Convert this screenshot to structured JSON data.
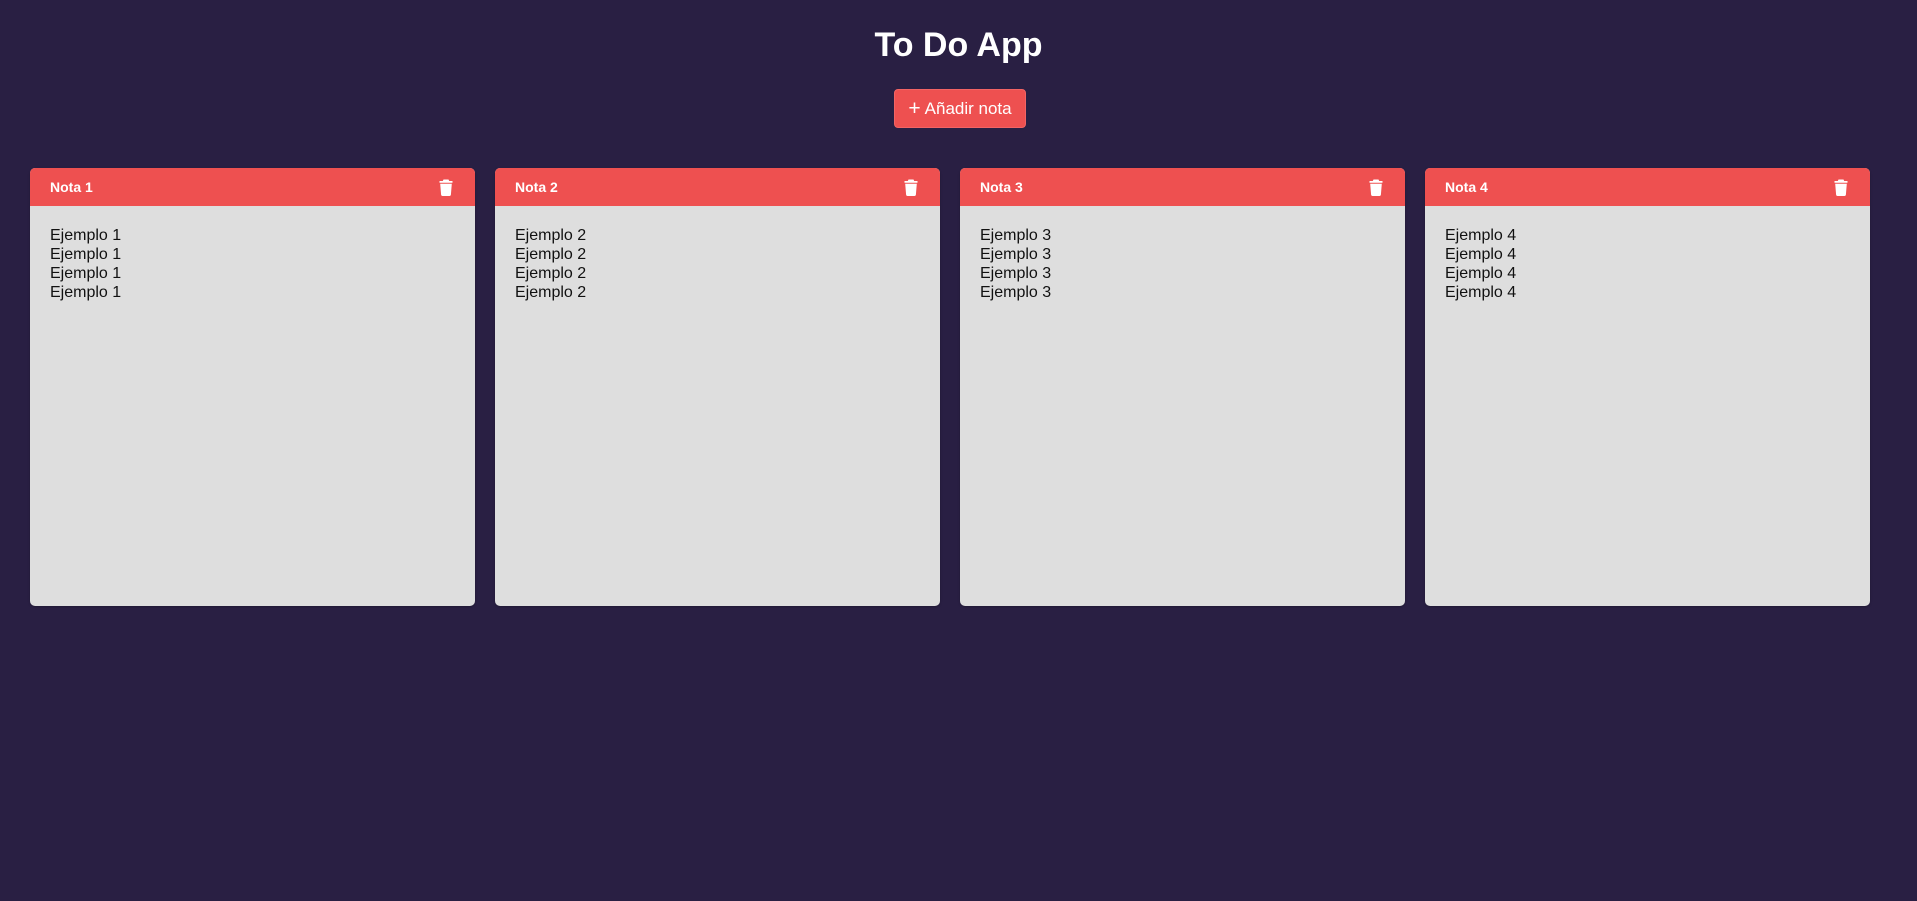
{
  "header": {
    "title": "To Do App"
  },
  "toolbar": {
    "add_icon": "+",
    "add_label": "Añadir nota"
  },
  "notes": [
    {
      "title": "Nota 1",
      "delete_icon": "trash-icon",
      "lines": [
        "Ejemplo 1",
        "Ejemplo 1",
        "Ejemplo 1",
        "Ejemplo 1"
      ]
    },
    {
      "title": "Nota 2",
      "delete_icon": "trash-icon",
      "lines": [
        "Ejemplo 2",
        "Ejemplo 2",
        "Ejemplo 2",
        "Ejemplo 2"
      ]
    },
    {
      "title": "Nota 3",
      "delete_icon": "trash-icon",
      "lines": [
        "Ejemplo 3",
        "Ejemplo 3",
        "Ejemplo 3",
        "Ejemplo 3"
      ]
    },
    {
      "title": "Nota 4",
      "delete_icon": "trash-icon",
      "lines": [
        "Ejemplo 4",
        "Ejemplo 4",
        "Ejemplo 4",
        "Ejemplo 4"
      ]
    }
  ],
  "colors": {
    "background": "#291f43",
    "accent": "#ee5050",
    "note_body": "#dedede",
    "text_light": "#ffffff",
    "text_dark": "#111111"
  }
}
